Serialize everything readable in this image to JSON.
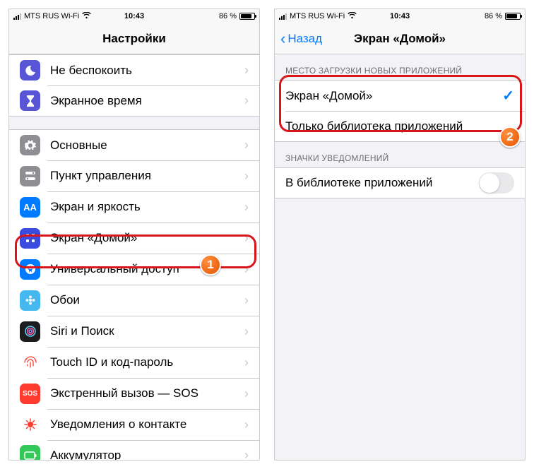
{
  "status": {
    "carrier": "MTS RUS Wi-Fi",
    "time": "10:43",
    "battery_pct": "86 %"
  },
  "left": {
    "title": "Настройки",
    "items": [
      {
        "label": "Не беспокоить"
      },
      {
        "label": "Экранное время"
      },
      {
        "label": "Основные"
      },
      {
        "label": "Пункт управления"
      },
      {
        "label": "Экран и яркость"
      },
      {
        "label": "Экран «Домой»"
      },
      {
        "label": "Универсальный доступ"
      },
      {
        "label": "Обои"
      },
      {
        "label": "Siri и Поиск"
      },
      {
        "label": "Touch ID и код-пароль"
      },
      {
        "label": "Экстренный вызов — SOS"
      },
      {
        "label": "Уведомления о контакте"
      },
      {
        "label": "Аккумулятор"
      }
    ]
  },
  "right": {
    "back": "Назад",
    "title": "Экран «Домой»",
    "section1": "МЕСТО ЗАГРУЗКИ НОВЫХ ПРИЛОЖЕНИЙ",
    "option1": "Экран «Домой»",
    "option2": "Только библиотека приложений",
    "section2": "ЗНАЧКИ УВЕДОМЛЕНИЙ",
    "toggleLabel": "В библиотеке приложений"
  },
  "annotations": {
    "badge1": "1",
    "badge2": "2"
  }
}
